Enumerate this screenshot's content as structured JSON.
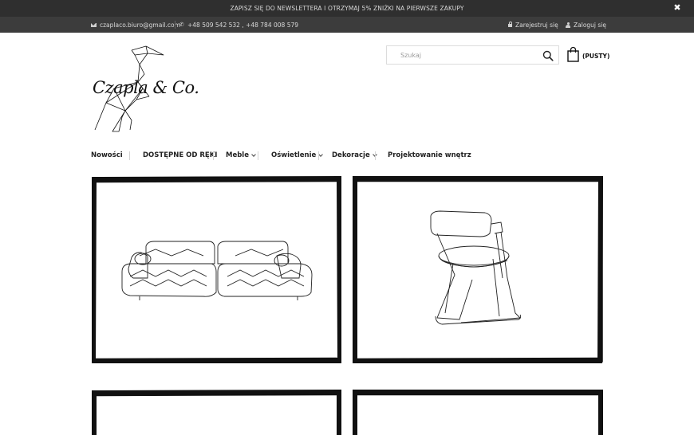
{
  "newsletter": {
    "text": "ZAPISZ SIĘ DO NEWSLETTERA I OTRZYMAJ 5% ZNIŻKI NA PIERWSZE ZAKUPY",
    "close_icon": "close-icon"
  },
  "contact": {
    "email": "czaplaco.biuro@gmail.com",
    "phone": "+48 509 542 532 , +48 784 008 579"
  },
  "account": {
    "register": "Zarejestruj się",
    "login": "Zaloguj się"
  },
  "brand": {
    "name": "Czapla & Co."
  },
  "search": {
    "placeholder": "Szukaj",
    "icon": "search-icon"
  },
  "cart": {
    "label": "(PUSTY)",
    "icon": "shopping-bag-icon"
  },
  "nav": {
    "items": [
      {
        "label": "Nowości",
        "has_dropdown": false
      },
      {
        "label": "DOSTĘPNE OD RĘKI",
        "has_dropdown": false
      },
      {
        "label": "Meble",
        "has_dropdown": true
      },
      {
        "label": "Oświetlenie",
        "has_dropdown": true
      },
      {
        "label": "Dekoracje",
        "has_dropdown": true
      },
      {
        "label": "Projektowanie wnętrz",
        "has_dropdown": false
      }
    ]
  },
  "tiles": [
    {
      "illustration": "sofa-illustration"
    },
    {
      "illustration": "chair-illustration"
    },
    {
      "illustration": "empty-frame"
    },
    {
      "illustration": "empty-frame"
    }
  ],
  "colors": {
    "top_bar": "#2f2f2f",
    "contact_bar": "#3c3c3c",
    "text": "#222222",
    "frame": "#111111"
  }
}
